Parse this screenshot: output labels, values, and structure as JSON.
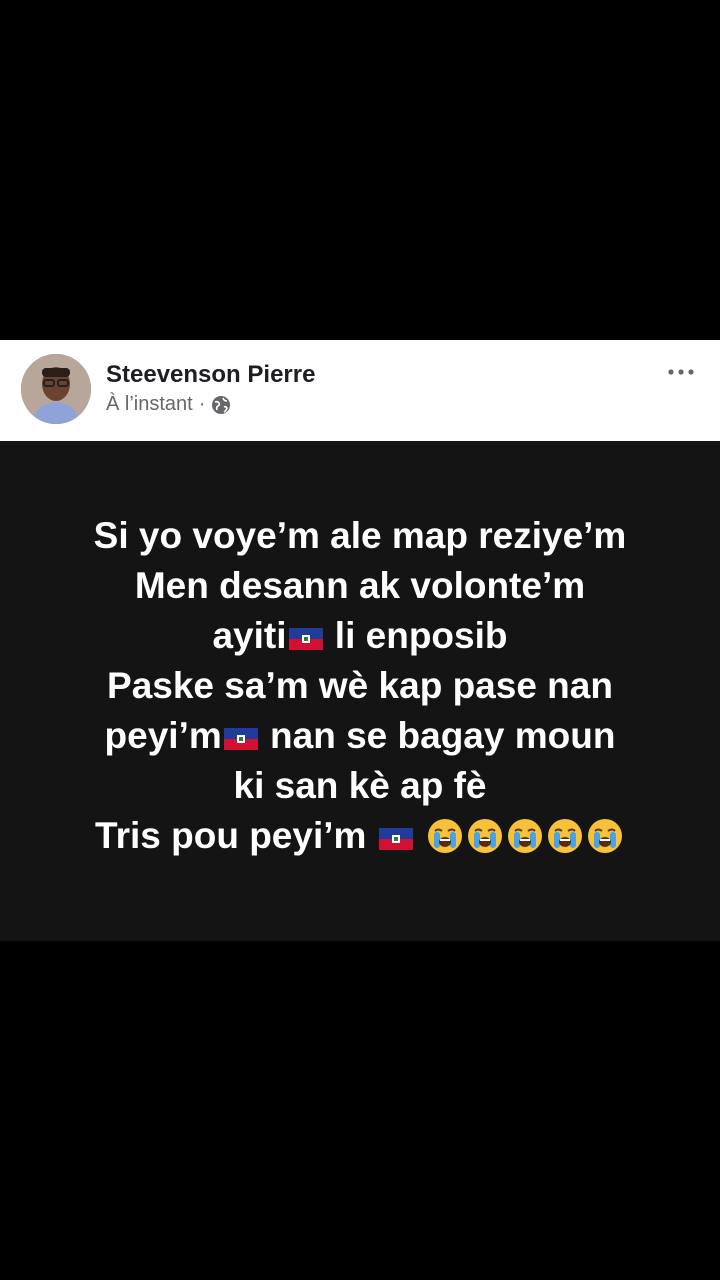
{
  "post": {
    "author": "Steevenson Pierre",
    "timestamp": "À l’instant",
    "separator": "·",
    "privacy_icon": "globe-icon",
    "more_icon": "more-options-icon"
  },
  "content": {
    "line1": "Si yo voye’m ale map reziye’m",
    "line2": "Men desann ak volonte’m",
    "line3a": "ayiti",
    "line3b": " li enposib",
    "line4": "Paske sa’m wè kap pase nan",
    "line5a": "peyi’m",
    "line5b": " nan se bagay moun",
    "line6": "ki san kè ap fè",
    "line7": "Tris pou peyi’m "
  },
  "colors": {
    "page_bg": "#000000",
    "header_bg": "#ffffff",
    "card_bg": "#141414",
    "text": "#ffffff",
    "name": "#1c1e21",
    "meta": "#65676b",
    "flag_blue": "#1f3c9a",
    "flag_red": "#d21034"
  }
}
